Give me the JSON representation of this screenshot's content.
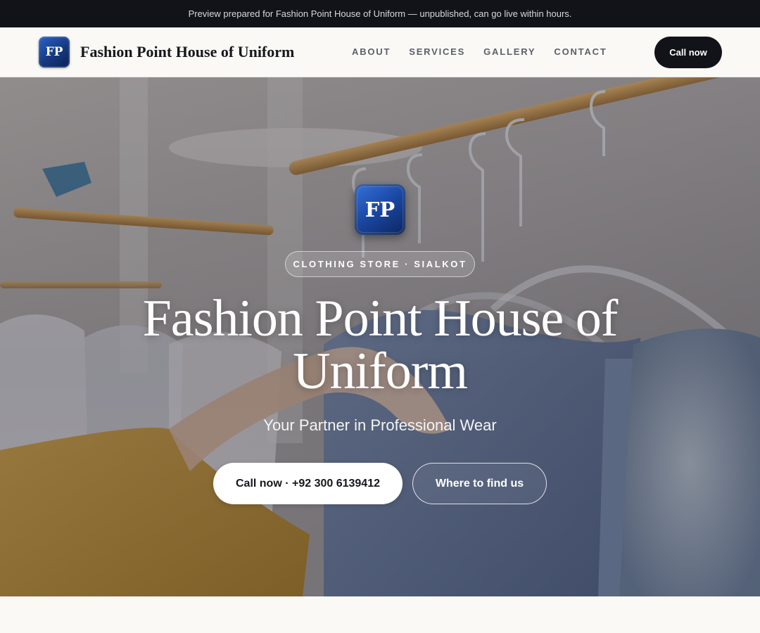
{
  "banner": {
    "text": "Preview prepared for Fashion Point House of Uniform — unpublished, can go live within hours."
  },
  "header": {
    "logo_text": "FP",
    "brand_name": "Fashion Point House of Uniform",
    "nav": [
      {
        "label": "ABOUT"
      },
      {
        "label": "SERVICES"
      },
      {
        "label": "GALLERY"
      },
      {
        "label": "CONTACT"
      }
    ],
    "cta_label": "Call now"
  },
  "hero": {
    "logo_text": "FP",
    "badge": "CLOTHING STORE · SIALKOT",
    "title": "Fashion Point House of Uniform",
    "subtitle": "Your Partner in Professional Wear",
    "primary_button": "Call now · +92 300 6139412",
    "secondary_button": "Where to find us",
    "background_image": "clothing-rack-photo"
  },
  "colors": {
    "dark": "#111318",
    "logo_blue": "#1a46a0",
    "page_bg": "#faf9f6",
    "nav_text": "#5a5f69"
  }
}
